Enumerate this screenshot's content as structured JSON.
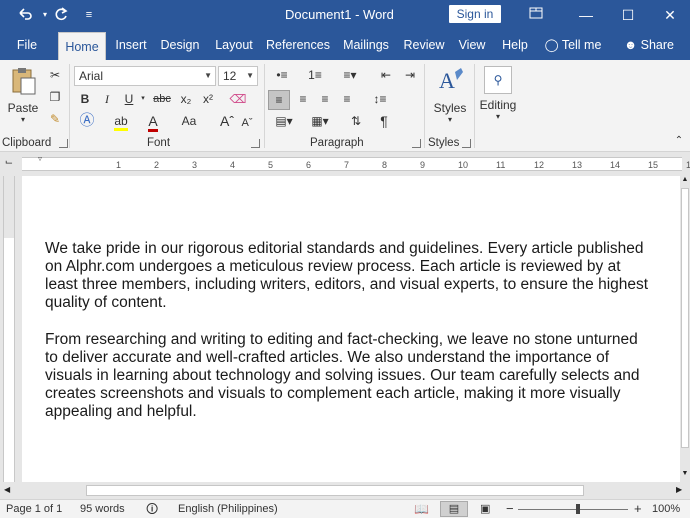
{
  "titlebar": {
    "title": "Document1 - Word",
    "signin_label": "Sign in",
    "undo_icon": "undo-icon",
    "redo_icon": "repeat-icon",
    "customize_icon": "customize-qat-icon",
    "minimize": "—",
    "maximize": "☐",
    "close": "✕"
  },
  "tabs": {
    "file": "File",
    "home": "Home",
    "insert": "Insert",
    "design": "Design",
    "layout": "Layout",
    "references": "References",
    "mailings": "Mailings",
    "review": "Review",
    "view": "View",
    "help": "Help",
    "tellme": "Tell me",
    "share": "Share"
  },
  "ribbon": {
    "clipboard": {
      "label": "Clipboard",
      "paste": "Paste"
    },
    "font": {
      "label": "Font",
      "family": "Arial",
      "size": "12",
      "bold": "B",
      "italic": "I",
      "underline": "U",
      "strike": "abc",
      "subscript": "x₂",
      "superscript": "x²",
      "case": "Aa"
    },
    "paragraph": {
      "label": "Paragraph"
    },
    "styles": {
      "label": "Styles",
      "button": "Styles"
    },
    "editing": {
      "button": "Editing"
    }
  },
  "ruler": {
    "numbers": [
      "1",
      "2",
      "3",
      "4",
      "5",
      "6",
      "7",
      "8",
      "9",
      "10",
      "11",
      "12",
      "13",
      "14",
      "15",
      "16"
    ]
  },
  "document": {
    "paragraphs": [
      [
        "We take pride in our rigorous editorial standards and guidelines. Every article published",
        "on Alphr.com undergoes a meticulous review process. Each article is reviewed by at",
        "least three members, including writers, editors, and visual experts, to ensure the highest",
        "quality of content."
      ],
      [
        "From researching and writing to editing and fact-checking, we leave no stone unturned",
        "to deliver accurate and well-crafted articles. We also understand the importance of",
        "visuals in learning about technology and solving issues. Our team carefully selects and",
        "creates screenshots and visuals to complement each article, making it more visually",
        "appealing and helpful."
      ]
    ]
  },
  "status": {
    "page": "Page 1 of 1",
    "words": "95 words",
    "language": "English (Philippines)",
    "zoom": "100%",
    "zoom_minus": "−",
    "zoom_plus": "+"
  },
  "colors": {
    "brand": "#2b579a",
    "highlight": "#ffff00",
    "font_color": "#c00000"
  }
}
